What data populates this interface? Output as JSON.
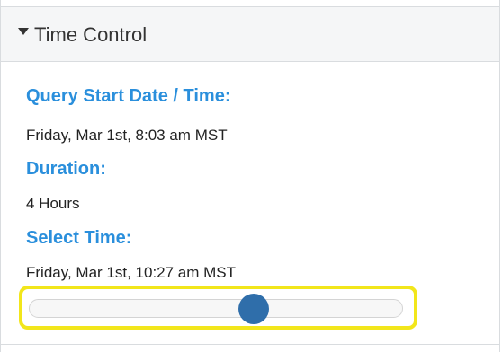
{
  "panel": {
    "title": "Time Control",
    "fields": {
      "query_start_label": "Query Start Date / Time:",
      "query_start_value": "Friday, Mar 1st, 8:03 am MST",
      "duration_label": "Duration:",
      "duration_value": "4 Hours",
      "select_time_label": "Select Time:",
      "select_time_value": "Friday, Mar 1st, 10:27 am MST"
    },
    "slider": {
      "position_fraction": 0.6,
      "accent_color": "#2f6eaa",
      "highlight_color": "#f2e61b"
    }
  },
  "icons": {
    "collapse": "caret-down-icon"
  },
  "colors": {
    "label": "#2a8fdc",
    "header_bg": "#f5f6f7"
  }
}
